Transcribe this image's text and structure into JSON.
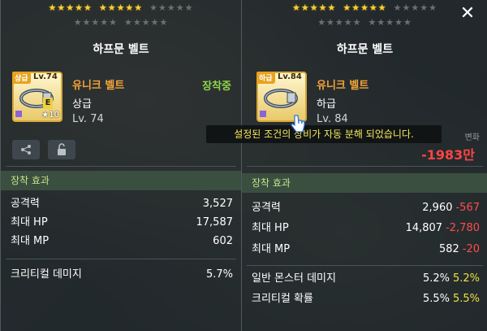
{
  "left_panel": {
    "title": "하프문 벨트",
    "icon": {
      "grade_tag": "상급",
      "level_tag": "Lv.74",
      "stars": "10"
    },
    "name": "유니크 벨트",
    "grade": "상급",
    "level": "Lv. 74",
    "equipped": "장착중",
    "section": "장착 효과",
    "stats": [
      {
        "label": "공격력",
        "value": "3,527"
      },
      {
        "label": "최대 HP",
        "value": "17,587"
      },
      {
        "label": "최대 MP",
        "value": "602"
      },
      {
        "label": "크리티컬 데미지",
        "value": "5.7%"
      }
    ]
  },
  "right_panel": {
    "title": "하프문 벨트",
    "icon": {
      "grade_tag": "하급",
      "level_tag": "Lv.84"
    },
    "name": "유니크 벨트",
    "grade": "하급",
    "level": "Lv. 84",
    "power_change_label": "변화",
    "power_change_value": "-1983만",
    "section": "장착 효과",
    "stats": [
      {
        "label": "공격력",
        "value": "2,960",
        "diff": "-567",
        "diff_type": "neg"
      },
      {
        "label": "최대 HP",
        "value": "14,807",
        "diff": "-2,780",
        "diff_type": "neg"
      },
      {
        "label": "최대 MP",
        "value": "582",
        "diff": "-20",
        "diff_type": "neg"
      },
      {
        "label": "일반 몬스터 데미지",
        "value": "5.2%",
        "diff": "5.2%",
        "diff_type": "pos"
      },
      {
        "label": "크리티컬 확률",
        "value": "5.5%",
        "diff": "5.5%",
        "diff_type": "pos"
      }
    ]
  },
  "toast": "설정된 조건의 장비가 자동 분해 되었습니다.",
  "colors": {
    "star_on": "#f7d23a",
    "neg": "#ff4c4c",
    "pos": "#f0e040",
    "name": "#f4a43a",
    "equipped": "#8fd34b"
  }
}
